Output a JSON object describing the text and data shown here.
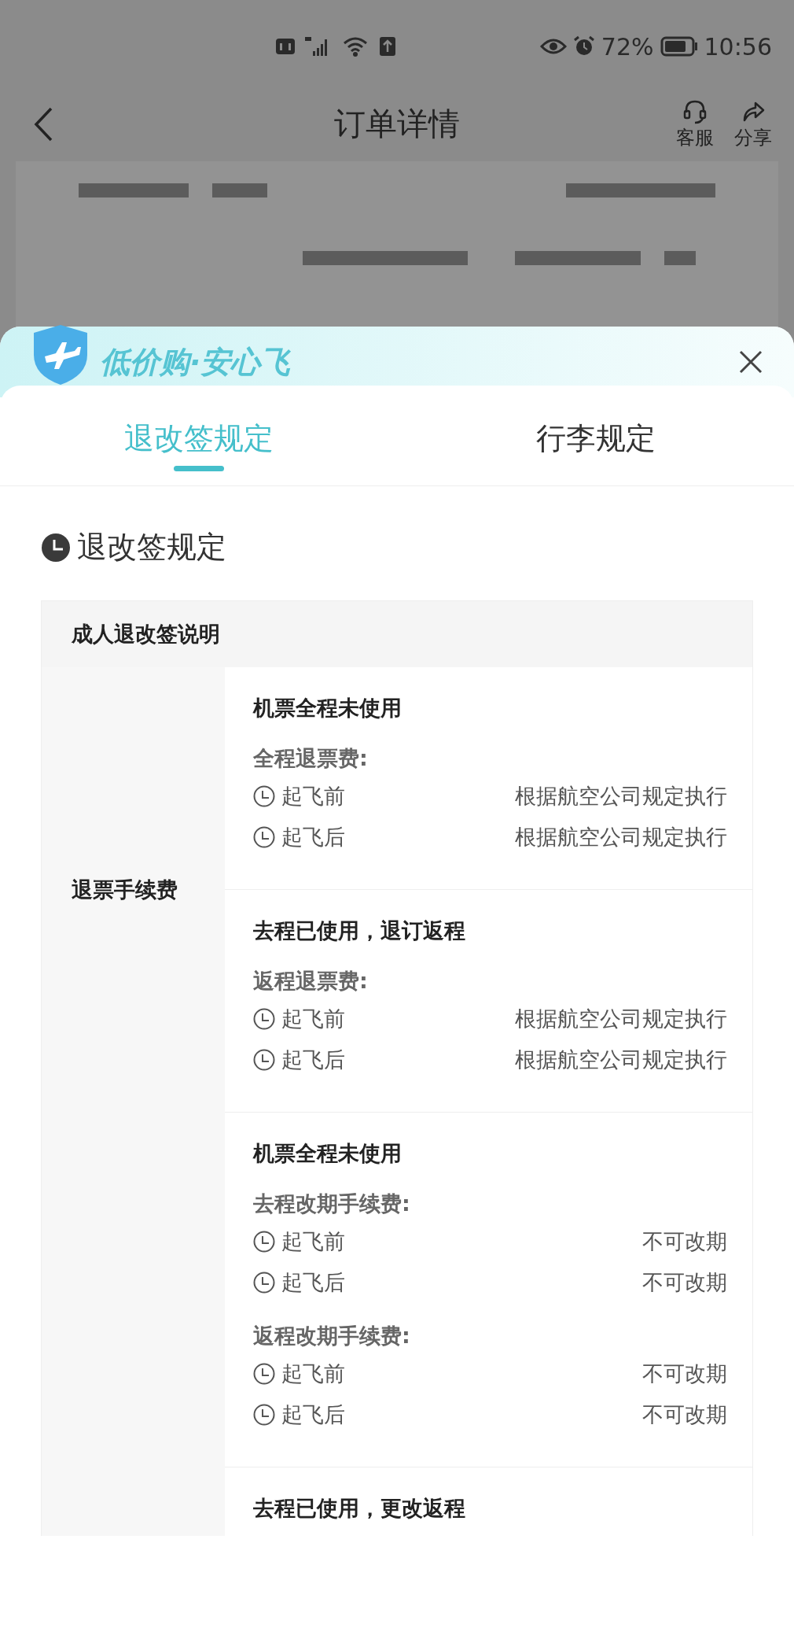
{
  "status_bar": {
    "battery": "72%",
    "time": "10:56"
  },
  "nav": {
    "title": "订单详情",
    "actions": [
      {
        "kind": "service",
        "label": "客服"
      },
      {
        "kind": "share",
        "label": "分享"
      }
    ]
  },
  "sheet": {
    "banner_title": "低价购·安心飞",
    "tabs": [
      {
        "label": "退改签规定",
        "selected": true
      },
      {
        "label": "行李规定",
        "selected": false
      }
    ],
    "section_title": "退改签规定",
    "table": {
      "header": "成人退改签说明",
      "groups": [
        {
          "label": "退票手续费",
          "blocks": [
            {
              "title": "机票全程未使用",
              "fees": [
                {
                  "name": "全程退票费:",
                  "rows": [
                    {
                      "when": "起飞前",
                      "value": "根据航空公司规定执行"
                    },
                    {
                      "when": "起飞后",
                      "value": "根据航空公司规定执行"
                    }
                  ]
                }
              ]
            },
            {
              "title": "去程已使用，退订返程",
              "fees": [
                {
                  "name": "返程退票费:",
                  "rows": [
                    {
                      "when": "起飞前",
                      "value": "根据航空公司规定执行"
                    },
                    {
                      "when": "起飞后",
                      "value": "根据航空公司规定执行"
                    }
                  ]
                }
              ]
            }
          ]
        },
        {
          "blocks": [
            {
              "title": "机票全程未使用",
              "fees": [
                {
                  "name": "去程改期手续费:",
                  "rows": [
                    {
                      "when": "起飞前",
                      "value": "不可改期"
                    },
                    {
                      "when": "起飞后",
                      "value": "不可改期"
                    }
                  ]
                },
                {
                  "name": "返程改期手续费:",
                  "rows": [
                    {
                      "when": "起飞前",
                      "value": "不可改期"
                    },
                    {
                      "when": "起飞后",
                      "value": "不可改期"
                    }
                  ]
                }
              ]
            },
            {
              "title": "去程已使用，更改返程"
            }
          ]
        }
      ]
    }
  }
}
